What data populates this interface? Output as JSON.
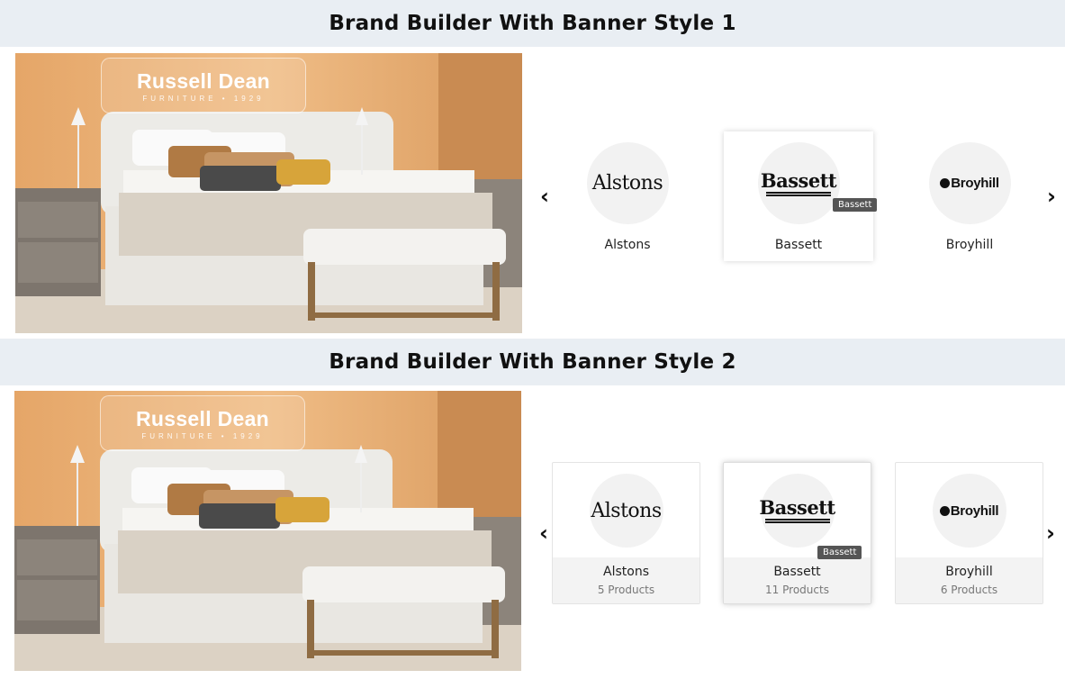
{
  "sections": [
    {
      "title": "Brand Builder With Banner Style 1",
      "banner": {
        "brand_logo": "Russell Dean",
        "brand_logo_sub": "FURNITURE • 1929",
        "image": "bedroom-photo"
      },
      "brands": [
        {
          "name": "Alstons",
          "logo_text": "Alstons"
        },
        {
          "name": "Bassett",
          "logo_text": "Bassett",
          "tooltip": "Bassett"
        },
        {
          "name": "Broyhill",
          "logo_text": "Broyhill"
        }
      ]
    },
    {
      "title": "Brand Builder With Banner Style 2",
      "banner": {
        "brand_logo": "Russell Dean",
        "brand_logo_sub": "FURNITURE • 1929",
        "image": "bedroom-photo"
      },
      "brands": [
        {
          "name": "Alstons",
          "logo_text": "Alstons",
          "count": "5 Products"
        },
        {
          "name": "Bassett",
          "logo_text": "Bassett",
          "count": "11 Products",
          "tooltip": "Bassett"
        },
        {
          "name": "Broyhill",
          "logo_text": "Broyhill",
          "count": "6 Products"
        }
      ]
    }
  ],
  "icons": {
    "prev": "chevron-left-icon",
    "next": "chevron-right-icon"
  },
  "colors": {
    "header_bg": "#e9eef3",
    "card_foot_bg": "#f3f3f3",
    "tooltip_bg": "#555555"
  }
}
